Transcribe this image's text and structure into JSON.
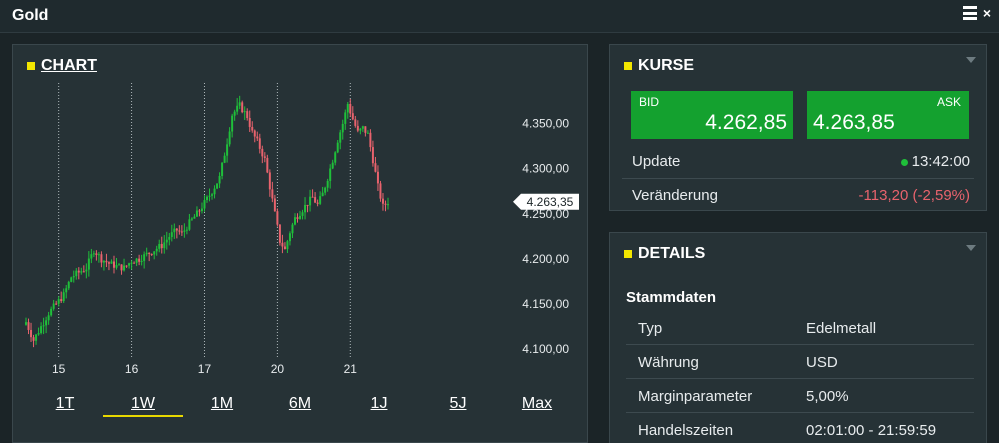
{
  "window": {
    "title": "Gold",
    "menu_icon": "hamburger-menu-icon",
    "close_glyph": "×"
  },
  "chart_panel": {
    "title": "CHART",
    "accent_color": "#f2e600",
    "range_buttons": [
      "1T",
      "1W",
      "1M",
      "6M",
      "1J",
      "5J",
      "Max"
    ],
    "active_range": "1W"
  },
  "chart_data": {
    "type": "candlestick",
    "x_tick_labels": [
      "15",
      "16",
      "17",
      "20",
      "21"
    ],
    "y_tick_labels": [
      "4.350,00",
      "4.300,00",
      "4.250,00",
      "4.200,00",
      "4.150,00",
      "4.100,00"
    ],
    "y_ticks": [
      4350,
      4300,
      4250,
      4200,
      4150,
      4100
    ],
    "ylim": [
      4088,
      4395
    ],
    "current_price_label": "4.263,35",
    "current_price": 4263.35,
    "up_color": "#1fbf3a",
    "down_color": "#e8636d",
    "close_path": [
      [
        0,
        4130
      ],
      [
        3,
        4110
      ],
      [
        6,
        4125
      ],
      [
        9,
        4140
      ],
      [
        12,
        4150
      ],
      [
        15,
        4160
      ],
      [
        18,
        4180
      ],
      [
        21,
        4185
      ],
      [
        24,
        4190
      ],
      [
        27,
        4210
      ],
      [
        30,
        4200
      ],
      [
        33,
        4195
      ],
      [
        36,
        4192
      ],
      [
        39,
        4190
      ],
      [
        42,
        4198
      ],
      [
        45,
        4200
      ],
      [
        48,
        4205
      ],
      [
        51,
        4210
      ],
      [
        54,
        4215
      ],
      [
        57,
        4225
      ],
      [
        60,
        4232
      ],
      [
        62,
        4228
      ],
      [
        65,
        4240
      ],
      [
        68,
        4250
      ],
      [
        71,
        4262
      ],
      [
        74,
        4275
      ],
      [
        77,
        4290
      ],
      [
        80,
        4330
      ],
      [
        82,
        4360
      ],
      [
        85,
        4370
      ],
      [
        88,
        4358
      ],
      [
        90,
        4340
      ],
      [
        92,
        4330
      ],
      [
        95,
        4310
      ],
      [
        97,
        4280
      ],
      [
        99,
        4250
      ],
      [
        101,
        4220
      ],
      [
        103,
        4210
      ],
      [
        105,
        4230
      ],
      [
        107,
        4245
      ],
      [
        110,
        4255
      ],
      [
        112,
        4262
      ],
      [
        114,
        4268
      ],
      [
        116,
        4260
      ],
      [
        118,
        4272
      ],
      [
        120,
        4290
      ],
      [
        122,
        4310
      ],
      [
        124,
        4332
      ],
      [
        126,
        4350
      ],
      [
        128,
        4372
      ],
      [
        130,
        4355
      ],
      [
        132,
        4340
      ],
      [
        134,
        4345
      ],
      [
        136,
        4338
      ],
      [
        138,
        4310
      ],
      [
        140,
        4280
      ],
      [
        142,
        4258
      ],
      [
        144,
        4263.35
      ]
    ]
  },
  "kurse_panel": {
    "title": "KURSE",
    "bid_label": "BID",
    "bid_value": "4.262,85",
    "ask_label": "ASK",
    "ask_value": "4.263,85",
    "quote_color": "#14a12f",
    "update_label": "Update",
    "update_time": "13:42:00",
    "change_label": "Veränderung",
    "change_value": "-113,20 (-2,59%)"
  },
  "details_panel": {
    "title": "DETAILS",
    "section": "Stammdaten",
    "rows": [
      {
        "key": "Typ",
        "value": "Edelmetall"
      },
      {
        "key": "Währung",
        "value": "USD"
      },
      {
        "key": "Marginparameter",
        "value": "5,00%"
      },
      {
        "key": "Handelszeiten",
        "value": "02:01:00 - 21:59:59"
      }
    ]
  }
}
